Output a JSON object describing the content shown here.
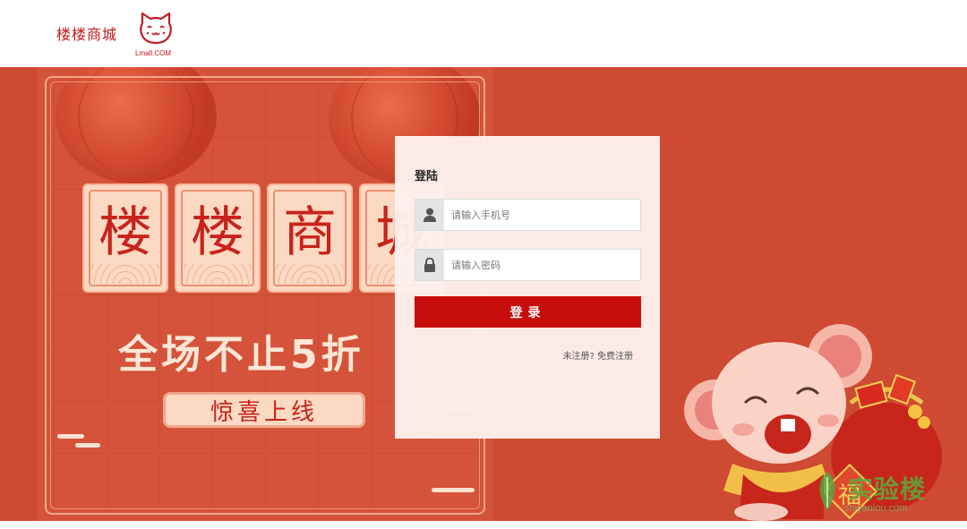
{
  "header": {
    "brand_name": "楼楼商城",
    "logo_text": "Lmall.COM"
  },
  "promo": {
    "tiles": [
      "楼",
      "楼",
      "商",
      "城"
    ],
    "slogan": "全场不止5折",
    "badge": "惊喜上线"
  },
  "login": {
    "title": "登陆",
    "phone_placeholder": "请输入手机号",
    "password_placeholder": "请输入密码",
    "submit_label": "登录",
    "register_prompt": "未注册?",
    "register_link": "免费注册"
  },
  "illustration": {
    "fortune_char": "福"
  },
  "watermark": {
    "text": "实验楼",
    "sub": "shiyanlou.com"
  },
  "colors": {
    "brand_red": "#c8161d",
    "banner_bg": "#cf4a32",
    "button_red": "#c80d0d"
  },
  "icons": [
    "cat-logo-icon",
    "user-icon",
    "lock-icon"
  ]
}
